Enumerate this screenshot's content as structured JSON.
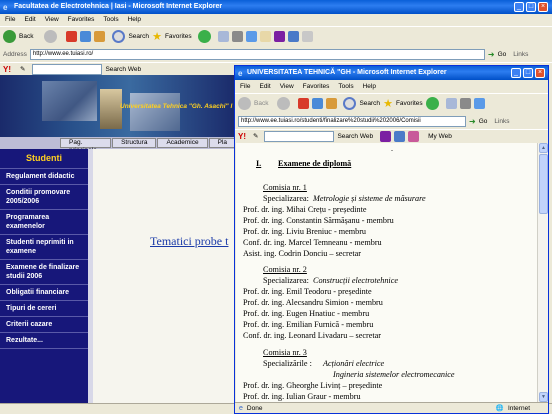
{
  "main_window": {
    "title": "Facultatea de Electrotehnica | Iasi - Microsoft Internet Explorer",
    "menu": [
      "File",
      "Edit",
      "View",
      "Favorites",
      "Tools",
      "Help"
    ],
    "toolbar": {
      "back": "Back",
      "search": "Search",
      "favorites": "Favorites"
    },
    "address_label": "Address",
    "url": "http://www.ee.tuiasi.ro/",
    "go": "Go",
    "links": "Links",
    "search_web": "Search Web"
  },
  "site": {
    "banner_text": "Universitatea Tehnica \"Gh. Asachi\" I",
    "nav_tabs": [
      "Pag. principala",
      "Structura",
      "Academice",
      "Pla"
    ],
    "sidebar_header": "Studenti",
    "sidebar_items": [
      "Regulament didactic",
      "Conditii promovare 2005/2006",
      "Programarea examenelor",
      "Studenti neprimiti in examene",
      "Examene de finalizare studii 2006",
      "Obligatii financiare",
      "Tipuri de cereri",
      "Criterii cazare",
      "Rezultate..."
    ],
    "link_text": "Tematici probe t"
  },
  "popup_window": {
    "title": "UNIVERSITATEA TEHNICĂ \"GH - Microsoft Internet Explorer",
    "menu": [
      "File",
      "Edit",
      "View",
      "Favorites",
      "Tools",
      "Help"
    ],
    "toolbar": {
      "back": "Back",
      "search": "Search",
      "favorites": "Favorites"
    },
    "url": "http://www.ee.tuiasi.ro/studenti/finalizare%20studii%202006/Comisii",
    "go": "Go",
    "links": "Links",
    "search_web": "Search Web",
    "my_web": "My Web",
    "status_left": "Done",
    "status_right": "Internet"
  },
  "document": {
    "heading_num": "I.",
    "heading": "Examene de diplomă",
    "dot": "-",
    "c1_title": "Comisia nr. 1",
    "c1_spec_label": "Specializarea:",
    "c1_spec": "Metrologie  și sisteme de măsurare",
    "c1_members": [
      "Prof. dr. ing. Mihai Crețu - președinte",
      "Prof. dr. ing. Constantin  Sărmășanu - membru",
      "Prof. dr. ing. Liviu Breniuc - membru",
      "Conf. dr. ing. Marcel Temneanu - membru",
      "Asist. ing. Codrin Donciu – secretar"
    ],
    "c2_title": "Comisia nr. 2",
    "c2_spec_label": "Specializarea:",
    "c2_spec": "Construcții electrotehnice",
    "c2_members": [
      "Prof. dr. ing. Emil Teodoru - președinte",
      "Prof. dr. ing. Alecsandru Simion - membru",
      "Prof. dr. ing. Eugen Hnatiuc - membru",
      "Prof. dr. ing. Emilian Furnică - membru",
      "Conf. dr. ing. Leonard Livadaru – secretar"
    ],
    "c3_title": "Comisia nr. 3",
    "c3_spec_label": "Specializările :",
    "c3_spec1": "Acționări electrice",
    "c3_spec2": "Ingineria sistemelor electromecanice",
    "c3_members": [
      "Prof. dr. ing. Gheorghe Livinț – președinte",
      "Prof. dr. ing. Iulian Graur - membru"
    ]
  }
}
